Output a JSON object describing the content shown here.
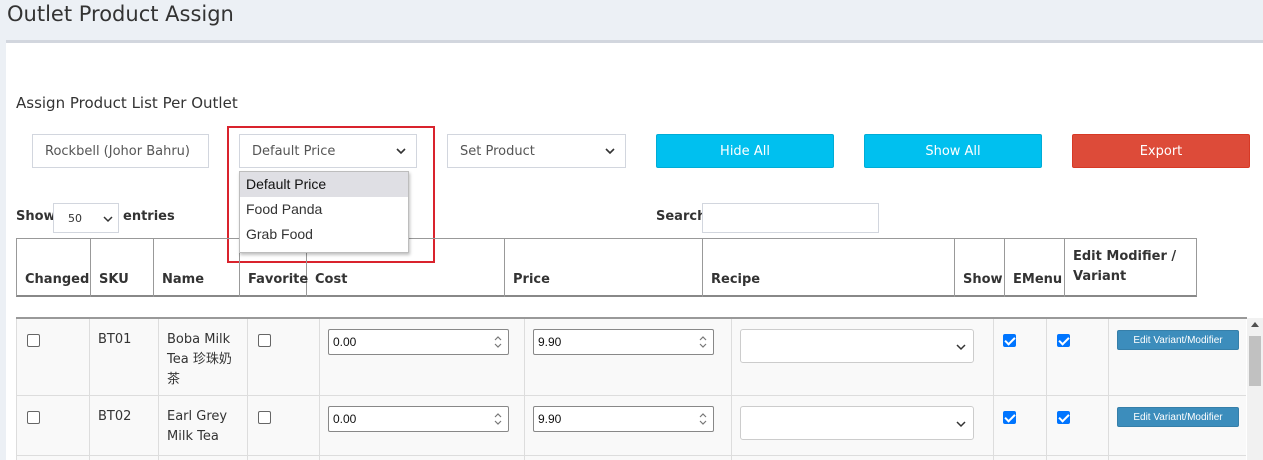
{
  "page": {
    "title": "Outlet Product Assign"
  },
  "box": {
    "title": "Assign Product List Per Outlet"
  },
  "filters": {
    "outlet": "Rockbell (Johor Bahru)",
    "price_type": "Default Price",
    "price_options": [
      "Default Price",
      "Food Panda",
      "Grab Food"
    ],
    "product_set": "Set Product"
  },
  "buttons": {
    "hide_all": "Hide All",
    "show_all": "Show All",
    "export": "Export"
  },
  "datatable": {
    "show_label": "Show",
    "entries_value": "50",
    "entries_label": "entries",
    "search_label": "Search:",
    "search_value": ""
  },
  "columns": [
    "Changed",
    "SKU",
    "Name",
    "Favorite",
    "Cost",
    "Price",
    "Recipe",
    "Show",
    "EMenu",
    "Edit Modifier / Variant"
  ],
  "rows": [
    {
      "changed": false,
      "sku": "BT01",
      "name": "Boba Milk Tea 珍珠奶茶",
      "favorite": false,
      "cost": "0.00",
      "price": "9.90",
      "recipe": "",
      "show": true,
      "emenu": true,
      "action": "Edit Variant/Modifier"
    },
    {
      "changed": false,
      "sku": "BT02",
      "name": "Earl Grey Milk Tea",
      "favorite": false,
      "cost": "0.00",
      "price": "9.90",
      "recipe": "",
      "show": true,
      "emenu": true,
      "action": "Edit Variant/Modifier"
    }
  ],
  "colors": {
    "accent_cyan": "#00c0ef",
    "danger": "#dd4b39",
    "primary": "#3c8dbc",
    "highlight": "#d9232d"
  }
}
